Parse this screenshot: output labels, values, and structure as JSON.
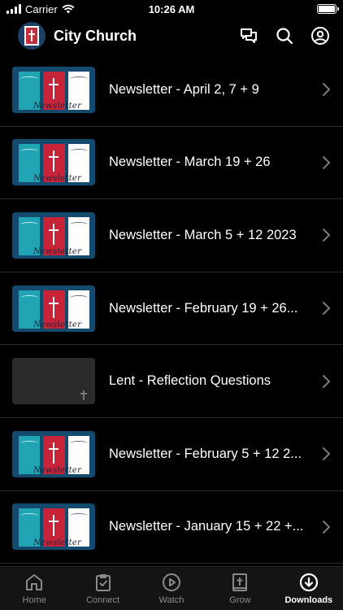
{
  "status_bar": {
    "carrier": "Carrier",
    "time": "10:26 AM"
  },
  "header": {
    "title": "City Church"
  },
  "list": [
    {
      "title": "Newsletter - April 2, 7 + 9",
      "thumb": "newsletter",
      "thumb_text": "Newsletter"
    },
    {
      "title": "Newsletter - March 19 + 26",
      "thumb": "newsletter",
      "thumb_text": "Newsletter"
    },
    {
      "title": "Newsletter - March 5 + 12 2023",
      "thumb": "newsletter",
      "thumb_text": "Newsletter"
    },
    {
      "title": "Newsletter - February 19 + 26...",
      "thumb": "newsletter",
      "thumb_text": "Newsletter"
    },
    {
      "title": "Lent - Reflection Questions",
      "thumb": "dark",
      "thumb_text": ""
    },
    {
      "title": "Newsletter - February 5 + 12 2...",
      "thumb": "newsletter",
      "thumb_text": "Newsletter"
    },
    {
      "title": "Newsletter - January 15 + 22 +...",
      "thumb": "newsletter",
      "thumb_text": "Newsletter"
    }
  ],
  "tabs": [
    {
      "label": "Home",
      "icon": "home-icon",
      "active": false
    },
    {
      "label": "Connect",
      "icon": "checklist-icon",
      "active": false
    },
    {
      "label": "Watch",
      "icon": "play-icon",
      "active": false
    },
    {
      "label": "Grow",
      "icon": "bible-icon",
      "active": false
    },
    {
      "label": "Downloads",
      "icon": "download-icon",
      "active": true
    }
  ],
  "colors": {
    "background": "#000000",
    "tab_active": "#ffffff",
    "tab_inactive": "#8a8a8a",
    "newsletter_navy": "#134a6e",
    "newsletter_teal": "#21a4b3",
    "newsletter_red": "#c7243a"
  }
}
